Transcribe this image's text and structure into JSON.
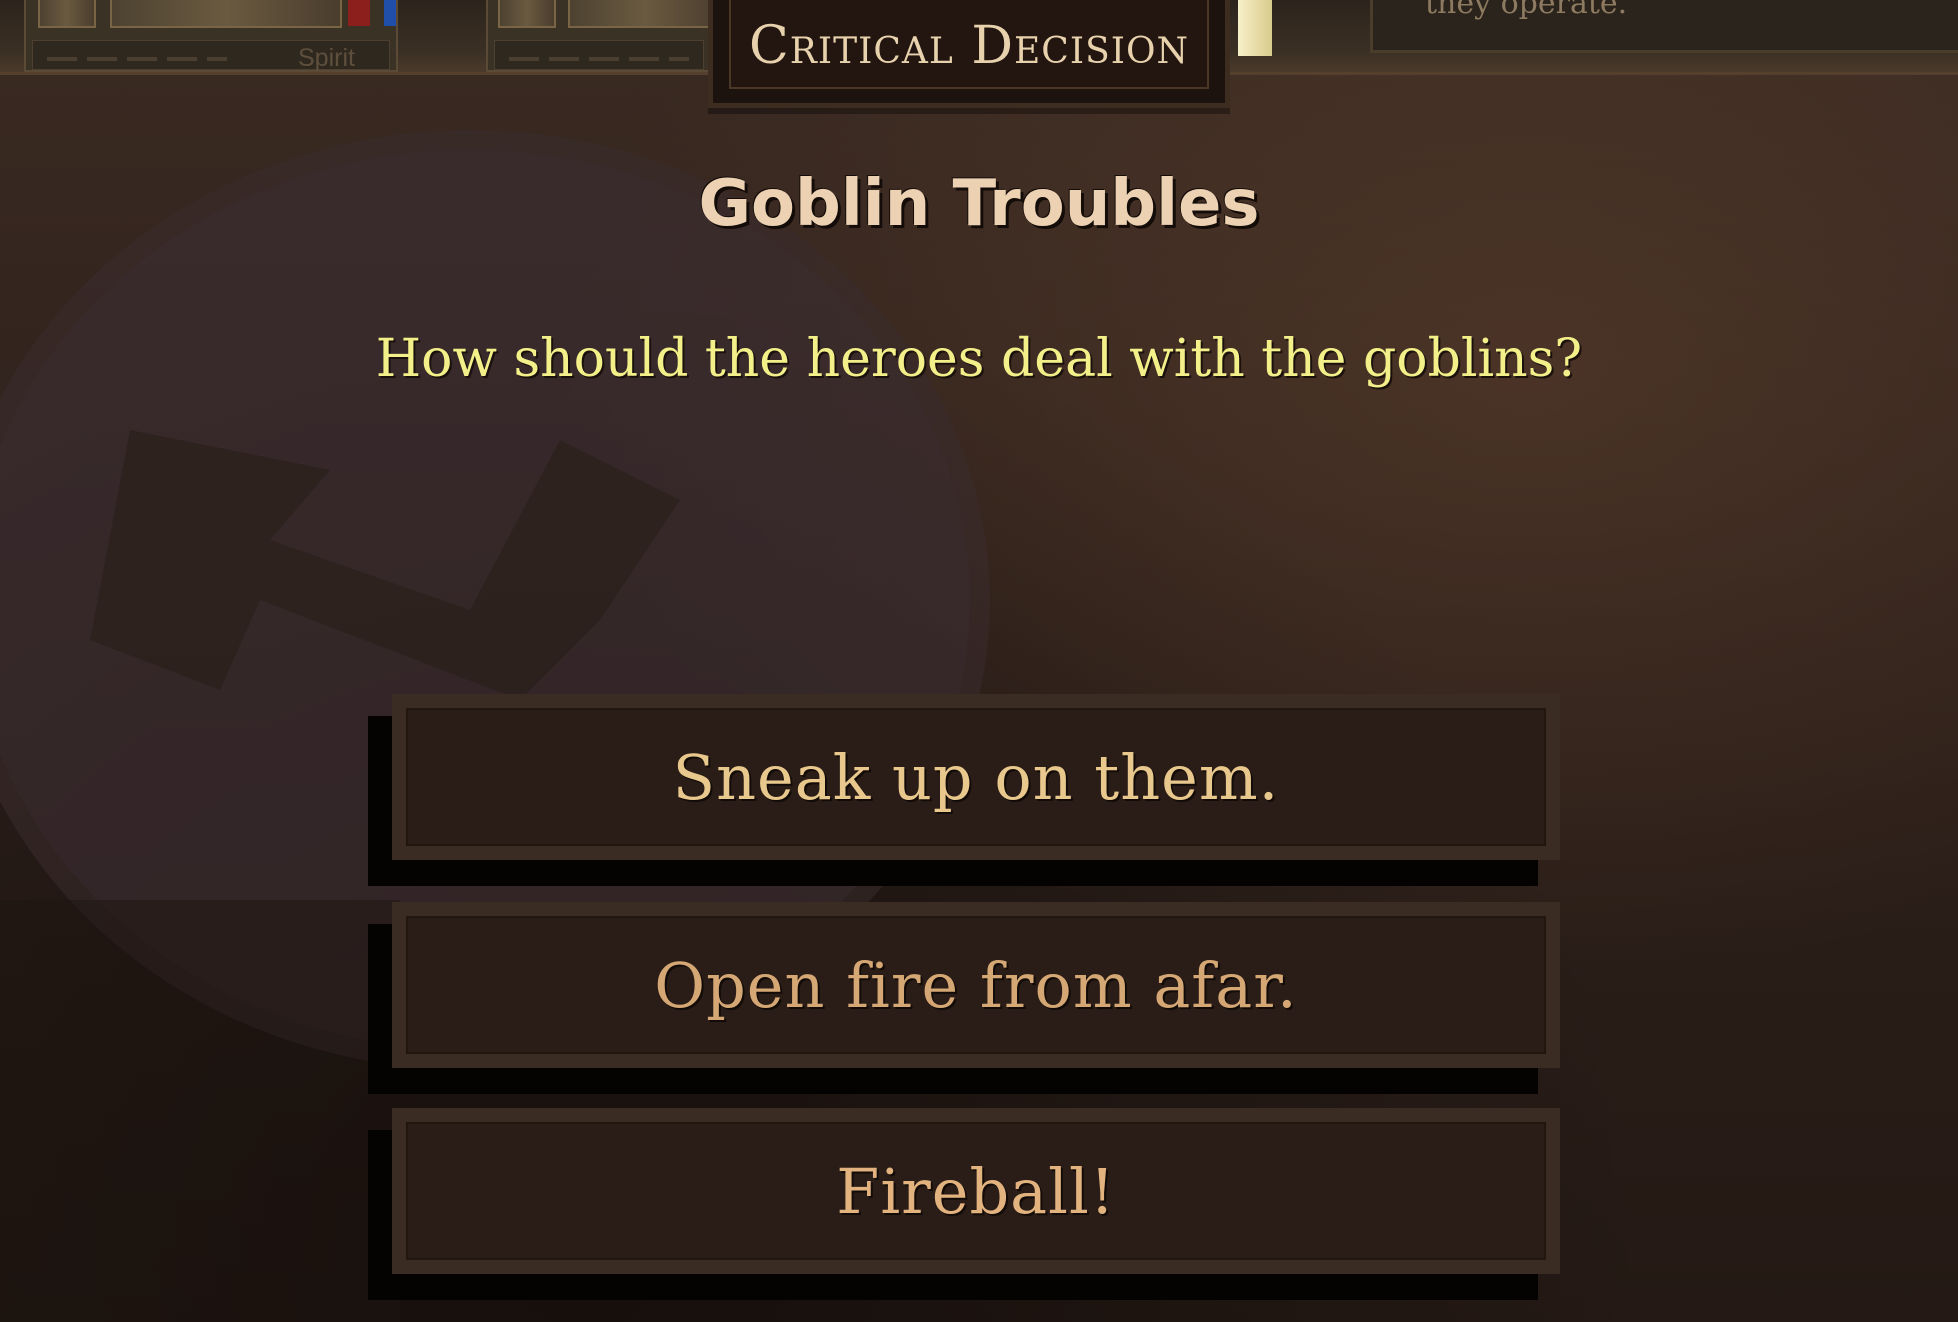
{
  "top_bar": {
    "spirit_label": "Spirit",
    "snippet_text": "they operate."
  },
  "decision": {
    "tab_label": "Critical Decision",
    "title": "Goblin Troubles",
    "question": "How should the heroes deal with the goblins?"
  },
  "choices": [
    {
      "label": "Sneak up on them."
    },
    {
      "label": "Open fire from afar."
    },
    {
      "label": "Fireball!"
    }
  ],
  "colors": {
    "background": "#2e211b",
    "title": "#ecd1b2",
    "question": "#f3f08a",
    "choice_text": "#e8c88c",
    "tab_text": "#e8d2ad",
    "health_bar": "#8c1f1c",
    "mana_bar": "#1f4fa8"
  }
}
